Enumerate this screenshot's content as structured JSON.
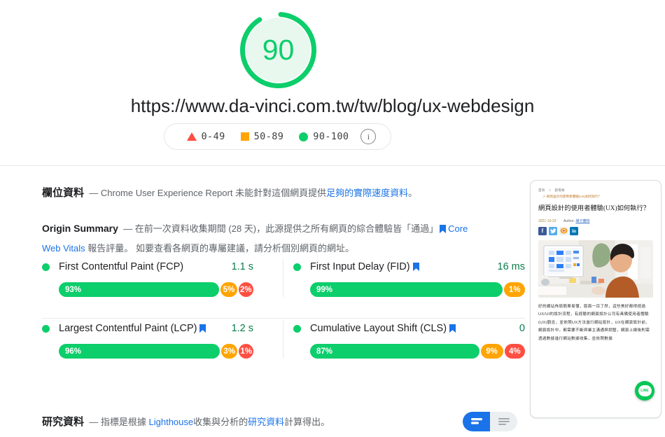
{
  "header": {
    "score": "90",
    "score_color": "#0cce6b",
    "url": "https://www.da-vinci.com.tw/tw/blog/ux-webdesign",
    "legend": [
      {
        "icon": "red-triangle-icon",
        "label": "0-49",
        "color": "#ff4e42"
      },
      {
        "icon": "orange-square-icon",
        "label": "50-89",
        "color": "#ffa400"
      },
      {
        "icon": "green-circle-icon",
        "label": "90-100",
        "color": "#0cce6b"
      }
    ],
    "info_icon": "info-icon",
    "info_glyph": "i"
  },
  "field_data": {
    "heading": "欄位資料",
    "dash": "—",
    "text_before": "Chrome User Experience Report 未能針對這個網頁提供",
    "link": "足夠的實際速度資料",
    "text_after": "。"
  },
  "origin_summary": {
    "heading": "Origin Summary",
    "dash": "—",
    "line1_text": "在前一次資料收集期間 (28 天)，此源提供之所有網頁的綜合體驗皆「通過」",
    "flag_icon": "blue-flag-icon",
    "link1": "Core",
    "link2": "Web Vitals",
    "line2_text_a": "報告評量。",
    "line2_text_b": "如要查看各網頁的專屬建議，請分析個別網頁的網址。"
  },
  "metrics": [
    {
      "status_icon": "green-circle-icon",
      "name": "First Contentful Paint (FCP)",
      "has_flag": false,
      "value": "1.1 s",
      "distribution": [
        {
          "label": "93%",
          "pct": 93,
          "bucket": "good"
        },
        {
          "label": "5%",
          "pct": 5,
          "bucket": "avg"
        },
        {
          "label": "2%",
          "pct": 2,
          "bucket": "bad"
        }
      ]
    },
    {
      "status_icon": "green-circle-icon",
      "name": "First Input Delay (FID)",
      "has_flag": true,
      "value": "16 ms",
      "distribution": [
        {
          "label": "99%",
          "pct": 99,
          "bucket": "good"
        },
        {
          "label": "1%",
          "pct": 1,
          "bucket": "avg"
        }
      ]
    },
    {
      "status_icon": "green-circle-icon",
      "name": "Largest Contentful Paint (LCP)",
      "has_flag": true,
      "value": "1.2 s",
      "distribution": [
        {
          "label": "96%",
          "pct": 96,
          "bucket": "good"
        },
        {
          "label": "3%",
          "pct": 3,
          "bucket": "avg"
        },
        {
          "label": "1%",
          "pct": 1,
          "bucket": "bad"
        }
      ]
    },
    {
      "status_icon": "green-circle-icon",
      "name": "Cumulative Layout Shift (CLS)",
      "has_flag": true,
      "value": "0",
      "distribution": [
        {
          "label": "87%",
          "pct": 87,
          "bucket": "good"
        },
        {
          "label": "9%",
          "pct": 9,
          "bucket": "avg"
        },
        {
          "label": "4%",
          "pct": 4,
          "bucket": "bad"
        }
      ]
    }
  ],
  "lab_data": {
    "heading": "研究資料",
    "dash": "—",
    "text_before": "指標是根據 ",
    "link1": "Lighthouse",
    "text_mid": " 收集與分析的",
    "link2": "研究資料",
    "text_after": "計算得出。"
  },
  "view_toggle": {
    "active_icon": "card-view-icon",
    "inactive_icon": "list-view-icon"
  },
  "preview": {
    "breadcrumb_home": "首頁",
    "breadcrumb_sep": "＞",
    "breadcrumb_blog": "部落格",
    "breadcrumb_current": "＞ 網頁設計的使用者體驗(UX)如何執行？",
    "title": "網頁設計的使用者體驗(UX)如何執行？",
    "date": "2021-10-23",
    "author_label": "Author:",
    "author_name": "維卡蘿特",
    "social": [
      {
        "icon": "facebook-icon",
        "glyph": "f",
        "color": "#3b5998"
      },
      {
        "icon": "twitter-icon",
        "glyph": "t",
        "color": "#55acee"
      },
      {
        "icon": "weibo-icon",
        "glyph": "◉",
        "color": "#e6162d"
      },
      {
        "icon": "linkedin-icon",
        "glyph": "in",
        "color": "#0077b5"
      }
    ],
    "photo_alt": "person-at-computer-photo",
    "body_text": "好的網站佈局簡單易懂，版面一目了然，這些美好都得經過UX/UI的設計流程，有經驗的網頁設計公司有具備使用者體驗(UX)觀念，並依照UX方法進行網站設計，UX在網頁設計前、網頁設計中，都需要不斷與業主溝通與調整，網頁上線後則需透過數據進行網站數據收集，並依照數據",
    "chat_icon": "line-chat-icon",
    "chat_label": "LINE"
  }
}
